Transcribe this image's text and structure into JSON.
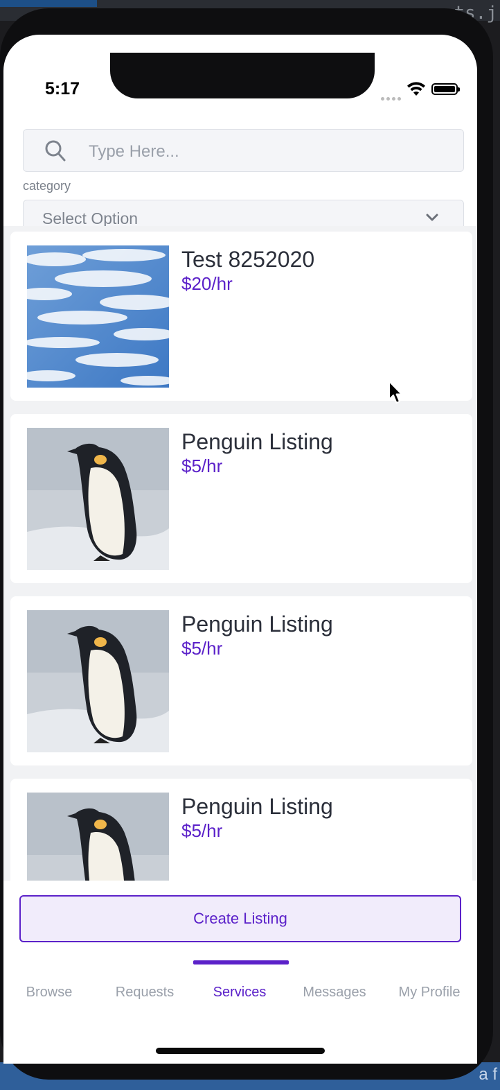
{
  "desktop": {
    "corner_text": "sts.j",
    "bottom_text": "a f"
  },
  "status": {
    "time": "5:17"
  },
  "search": {
    "placeholder": "Type Here..."
  },
  "filter": {
    "label": "category",
    "selected": "Select Option"
  },
  "listings": [
    {
      "title": "Test 8252020",
      "price": "$20/hr",
      "image": "sky-clouds"
    },
    {
      "title": "Penguin Listing",
      "price": "$5/hr",
      "image": "penguin"
    },
    {
      "title": "Penguin Listing",
      "price": "$5/hr",
      "image": "penguin"
    },
    {
      "title": "Penguin Listing",
      "price": "$5/hr",
      "image": "penguin"
    }
  ],
  "actions": {
    "create_label": "Create Listing"
  },
  "tabs": [
    {
      "label": "Browse"
    },
    {
      "label": "Requests"
    },
    {
      "label": "Services",
      "active": true
    },
    {
      "label": "Messages"
    },
    {
      "label": "My Profile"
    }
  ],
  "colors": {
    "accent": "#5b21c9",
    "muted": "#9aa0aa",
    "title": "#2b2f3a"
  }
}
